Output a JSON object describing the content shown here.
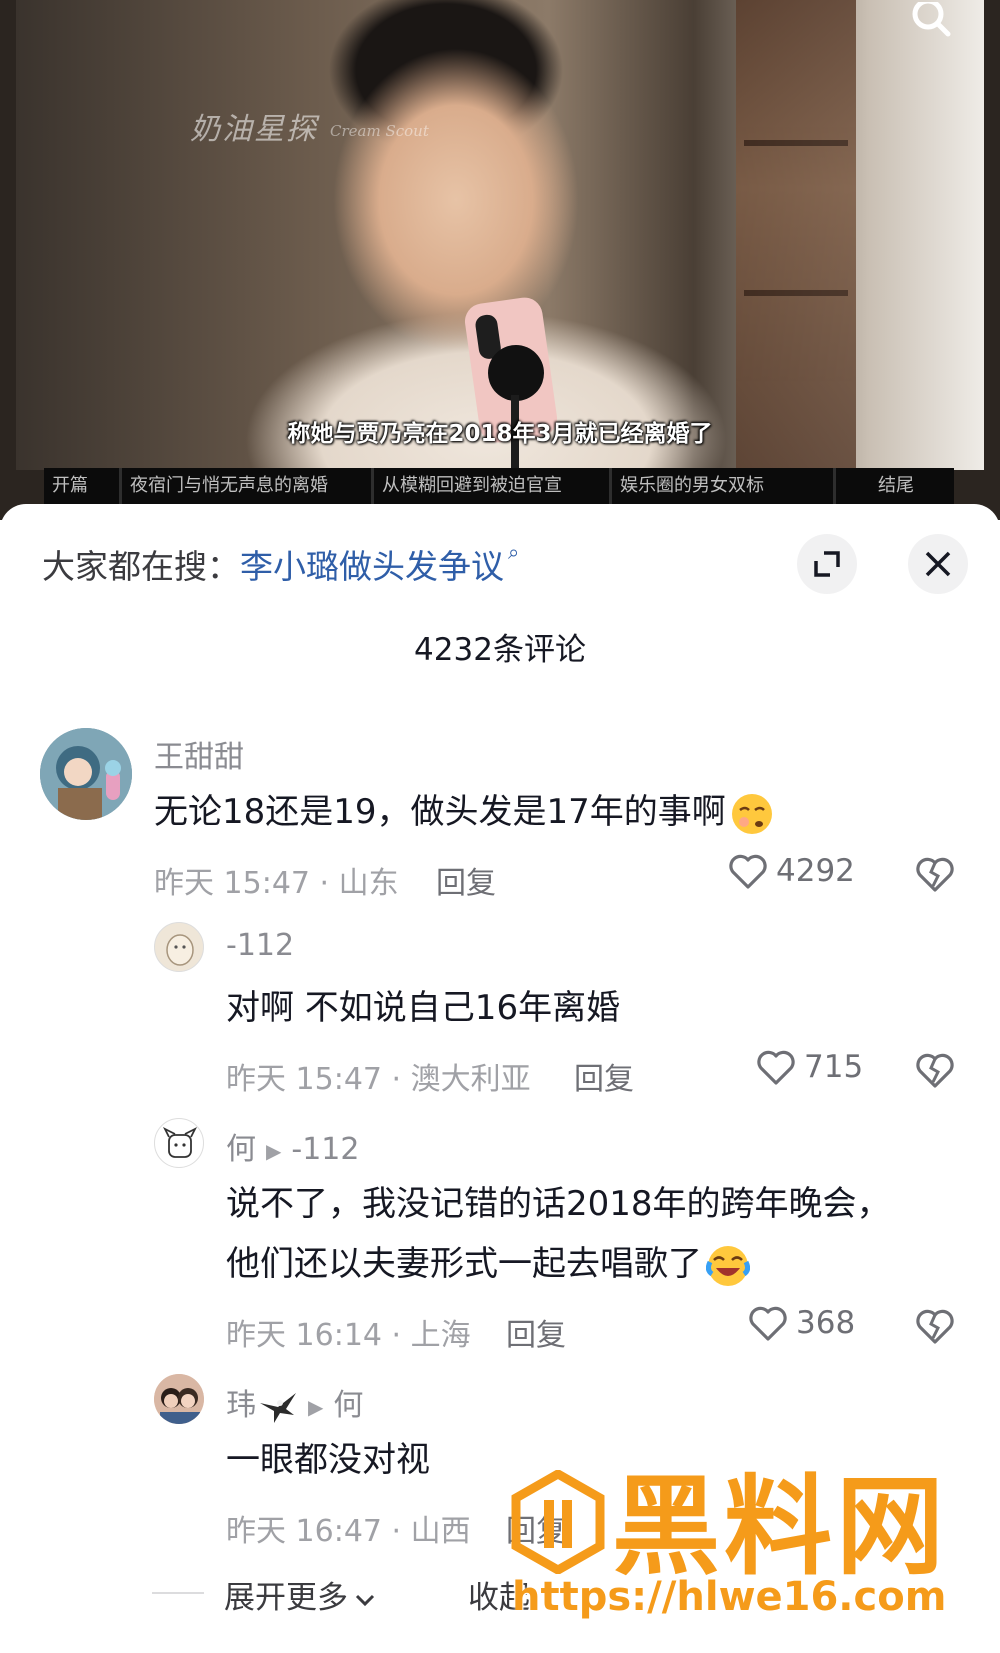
{
  "video": {
    "watermark_cn": "奶油星探",
    "watermark_en": "Cream Scout",
    "subtitle": "称她与贾乃亮在2018年3月就已经离婚了",
    "chapters": [
      "开篇",
      "夜宿门与悄无声息的离婚",
      "从模糊回避到被迫官宣",
      "娱乐圈的男女双标",
      "结尾"
    ]
  },
  "header": {
    "hot_search_prefix": "大家都在搜：",
    "hot_search_term": "李小璐做头发争议",
    "comment_count": "4232条评论"
  },
  "comments": [
    {
      "name": "王甜甜",
      "text": "无论18还是19，做头发是17年的事啊",
      "time": "昨天 15:47 · 山东",
      "reply": "回复",
      "likes": "4292"
    },
    {
      "name": "-112",
      "text": "对啊 不如说自己16年离婚",
      "time": "昨天 15:47 · 澳大利亚",
      "reply": "回复",
      "likes": "715"
    },
    {
      "name": "何",
      "reply_to": "-112",
      "text_line1": "说不了，我没记错的话2018年的跨年晚会，",
      "text_line2": "他们还以夫妻形式一起去唱歌了",
      "time": "昨天 16:14 · 上海",
      "reply": "回复",
      "likes": "368"
    },
    {
      "name": "玮",
      "reply_to": "何",
      "text": "一眼都没对视",
      "time": "昨天 16:47 · 山西",
      "reply": "回复"
    }
  ],
  "footer": {
    "expand_more": "展开更多",
    "collapse": "收起"
  },
  "brand_watermark": {
    "name": "黑料网",
    "url": "https://hlwe16.com"
  },
  "colors": {
    "link_blue": "#2f5ea8",
    "brand_orange": "#f59b1a",
    "meta_gray": "#a0a1a6"
  }
}
